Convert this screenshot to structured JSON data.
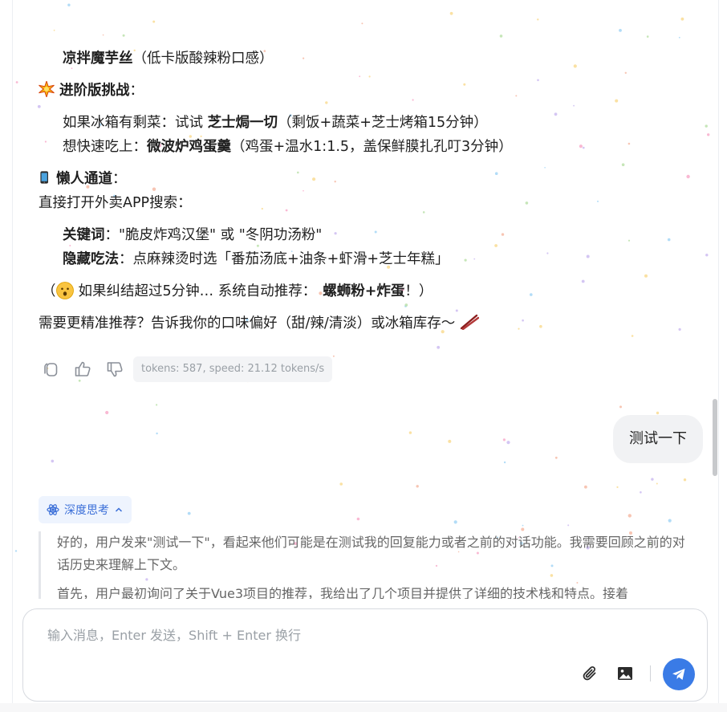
{
  "assistant_message": {
    "line_1": {
      "bold": "凉拌魔芋丝",
      "rest": "（低卡版酸辣粉口感）"
    },
    "advanced": {
      "heading": "进阶版挑战",
      "heading_suffix": "：",
      "icon": "sparkle-icon",
      "item_1": {
        "pre": "如果冰箱有剩菜：试试 ",
        "bold": "芝士焗一切",
        "rest": "（剩饭+蔬菜+芝士烤箱15分钟）"
      },
      "item_2": {
        "pre": "想快速吃上：",
        "bold": "微波炉鸡蛋羹",
        "rest": "（鸡蛋+温水1:1.5，盖保鲜膜扎孔叮3分钟）"
      }
    },
    "lazy": {
      "heading": "懒人通道",
      "heading_suffix": "：",
      "icon": "phone-icon",
      "intro": "直接打开外卖APP搜索：",
      "kw_label": "关键词",
      "kw_text": "：\"脆皮炸鸡汉堡\" 或 \"冬阴功汤粉\"",
      "hidden_label": "隐藏吃法",
      "hidden_text": "：点麻辣烫时选「番茄汤底+油条+虾滑+芝士年糕」"
    },
    "note": {
      "open": "（",
      "icon": "surprised-face-icon",
      "pre": "如果纠结超过5分钟… 系统自动推荐：",
      "bold": "螺蛳粉+炸蛋",
      "close": "！）"
    },
    "closing": {
      "text": "需要更精准推荐？告诉我你的口味偏好（甜/辣/清淡）或冰箱库存～",
      "icon": "chopsticks-icon"
    }
  },
  "toolbar": {
    "icons": [
      "copy-icon",
      "thumbs-up-icon",
      "thumbs-down-icon"
    ],
    "tokens_text": "tokens: 587, speed: 21.12 tokens/s"
  },
  "user_message": {
    "text": "测试一下"
  },
  "thinking": {
    "label": "深度思考",
    "icon": "atom-icon",
    "paragraph_1": "好的，用户发来\"测试一下\"，看起来他们可能是在测试我的回复能力或者之前的对话功能。我需要回顾之前的对话历史来理解上下文。",
    "paragraph_2": "首先，用户最初询问了关于Vue3项目的推荐，我给出了几个项目并提供了详细的技术栈和特点。接着"
  },
  "composer": {
    "placeholder": "输入消息，Enter 发送，Shift + Enter 换行",
    "value": "",
    "icons": [
      "attachment-icon",
      "image-icon",
      "send-icon"
    ]
  },
  "colors": {
    "accent": "#3a7be6",
    "think_bg": "#eef4fe",
    "bubble_bg": "#f1f2f4"
  }
}
